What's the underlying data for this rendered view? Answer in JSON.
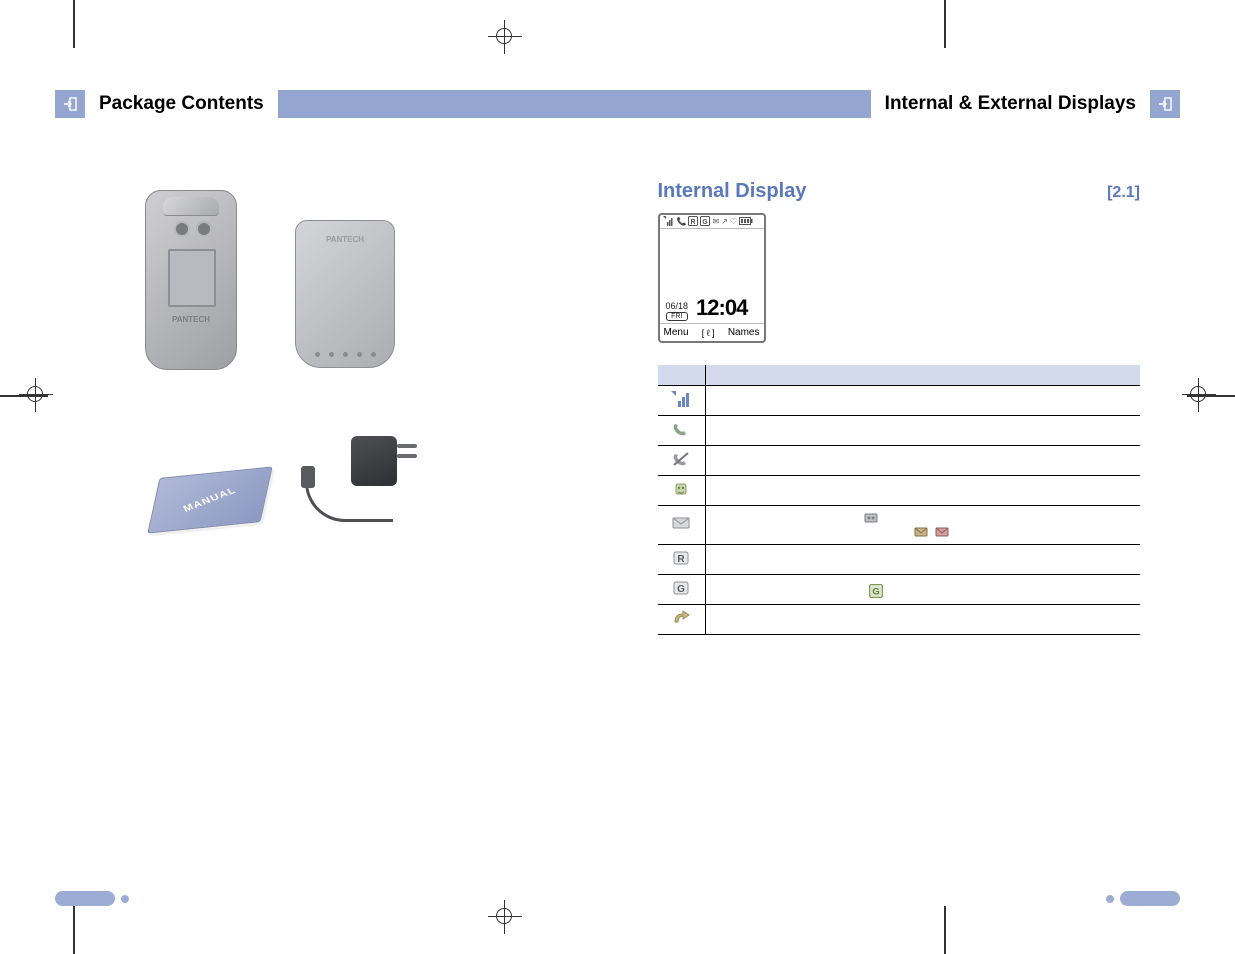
{
  "header": {
    "left_title": "Package Contents",
    "right_title": "Internal & External Displays"
  },
  "left_page": {
    "phone_brand": "PANTECH",
    "battery_brand": "PANTECH",
    "manual_label": "MANUAL"
  },
  "right_page": {
    "section_title": "Internal Display",
    "section_number": "[2.1]",
    "display": {
      "date": "06/18",
      "day": "FRI",
      "time": "12:04",
      "softkey_left": "Menu",
      "softkey_center": "[ ℓ ]",
      "softkey_right": "Names"
    },
    "icon_table": {
      "header_icon": "",
      "header_desc": "",
      "rows": [
        {
          "name": "signal-strength-icon",
          "desc": ""
        },
        {
          "name": "call-in-progress-icon",
          "desc": ""
        },
        {
          "name": "out-of-range-icon",
          "desc": ""
        },
        {
          "name": "vibrate-mode-icon",
          "desc": ""
        },
        {
          "name": "message-icon",
          "desc": ""
        },
        {
          "name": "roaming-icon",
          "desc": ""
        },
        {
          "name": "gprs-icon",
          "desc": ""
        },
        {
          "name": "call-divert-icon",
          "desc": ""
        }
      ]
    }
  },
  "footer": {
    "left_page_num": "",
    "right_page_num": ""
  }
}
